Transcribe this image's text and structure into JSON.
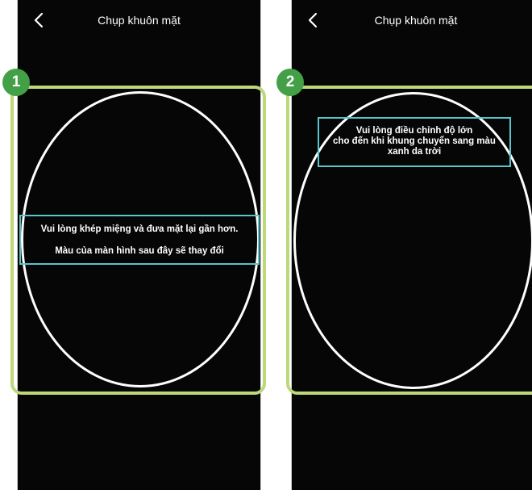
{
  "colors": {
    "screen_bg": "#060606",
    "frame_outline": "#ffffff",
    "message_border": "#59c4c9",
    "highlight_border": "#bdd77b",
    "badge_bg": "#43a047"
  },
  "icons": {
    "back": "chevron-left-icon"
  },
  "screens": [
    {
      "step": "1",
      "title": "Chụp khuôn mặt",
      "message_lines": [
        "Vui lòng khép miệng và đưa mặt lại gần hơn.",
        "Màu của màn hình sau đây sẽ thay đổi"
      ]
    },
    {
      "step": "2",
      "title": "Chụp khuôn mặt",
      "message_lines": [
        "Vui lòng điều chỉnh độ lớn",
        "cho đến khi khung chuyển sang màu",
        "xanh da trời"
      ]
    }
  ]
}
